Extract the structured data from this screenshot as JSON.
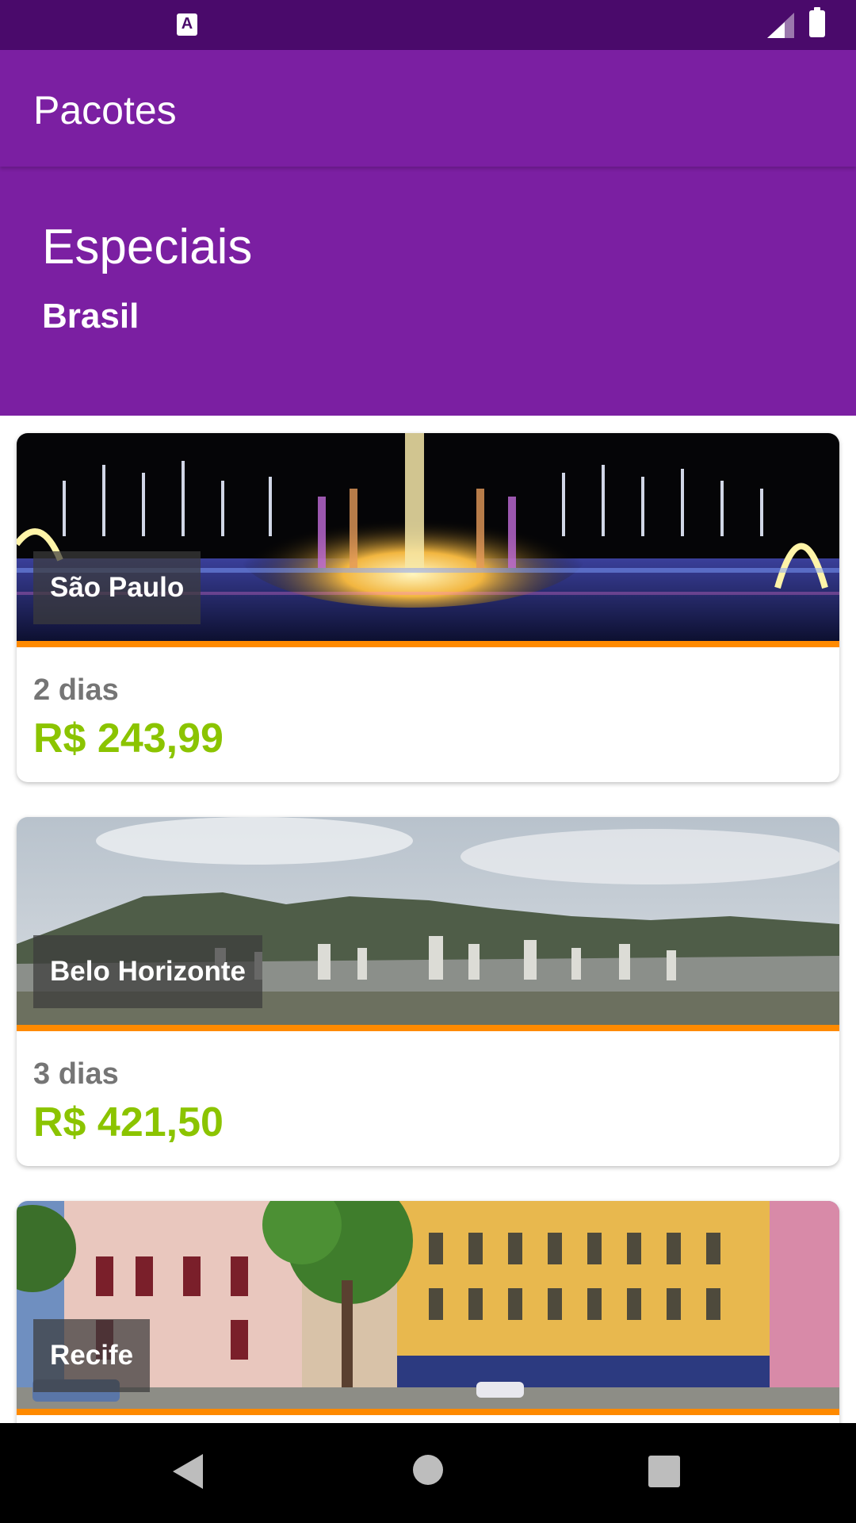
{
  "status_bar": {
    "app_icon": "A",
    "icons": [
      "signal-icon",
      "battery-icon"
    ]
  },
  "app_bar": {
    "title": "Pacotes"
  },
  "header": {
    "title": "Especiais",
    "subtitle": "Brasil"
  },
  "packages": [
    {
      "city": "São Paulo",
      "days": "2 dias",
      "price": "R$ 243,99",
      "image": "night fountain park"
    },
    {
      "city": "Belo Horizonte",
      "days": "3 dias",
      "price": "R$ 421,50",
      "image": "city skyline with mountains"
    },
    {
      "city": "Recife",
      "days": "",
      "price": "",
      "image": "colonial buildings street"
    }
  ],
  "colors": {
    "status_bar": "#4a0a6b",
    "primary": "#7b1fa2",
    "accent_strip": "#ff8a00",
    "price": "#8bc400",
    "days": "#757575"
  },
  "nav_bar": {
    "icons": [
      "back-icon",
      "home-icon",
      "recents-icon"
    ]
  }
}
